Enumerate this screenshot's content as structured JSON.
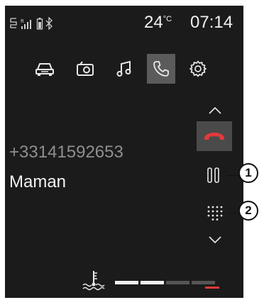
{
  "status": {
    "temperature": "24",
    "temperature_unit": "°C",
    "time": "07:14"
  },
  "nav": {
    "items": [
      {
        "icon": "car-icon"
      },
      {
        "icon": "radio-icon"
      },
      {
        "icon": "music-icon"
      },
      {
        "icon": "phone-icon",
        "active": true
      },
      {
        "icon": "gear-icon"
      }
    ]
  },
  "call": {
    "number": "+33141592653",
    "contact": "Maman"
  },
  "callouts": {
    "one": "1",
    "two": "2"
  },
  "colors": {
    "background": "#1b1b1b",
    "hangup": "#e23a3a",
    "active_tab": "#5b5b5b"
  }
}
